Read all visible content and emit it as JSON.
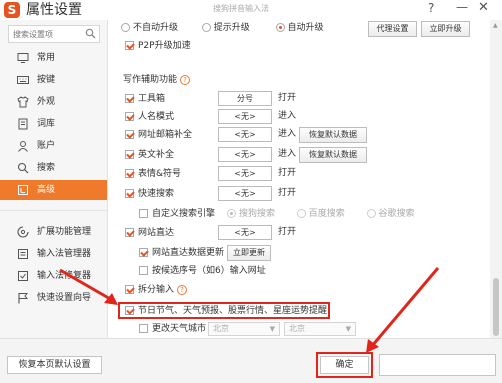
{
  "window": {
    "title": "属性设置",
    "subtitle": "搜狗拼音输入法",
    "help": "?",
    "minimize": "—",
    "close": "✕",
    "logo": "S"
  },
  "sidebar": {
    "search_placeholder": "搜索设置项",
    "items": [
      {
        "label": "常用",
        "icon": "monitor-icon"
      },
      {
        "label": "按键",
        "icon": "keyboard-icon"
      },
      {
        "label": "外观",
        "icon": "shirt-icon"
      },
      {
        "label": "词库",
        "icon": "book-icon"
      },
      {
        "label": "账户",
        "icon": "user-icon"
      },
      {
        "label": "搜索",
        "icon": "search-icon"
      },
      {
        "label": "高级",
        "icon": "advanced-icon",
        "active": true
      }
    ],
    "tools": [
      {
        "label": "扩展功能管理",
        "icon": "extension-icon"
      },
      {
        "label": "输入法管理器",
        "icon": "manager-icon"
      },
      {
        "label": "输入法修复器",
        "icon": "repair-icon"
      },
      {
        "label": "快速设置向导",
        "icon": "flag-icon"
      }
    ]
  },
  "upgrade": {
    "options": [
      "不自动升级",
      "提示升级",
      "自动升级"
    ],
    "selected": "自动升级",
    "proxy_button": "代理设置",
    "upgrade_now_button": "立即升级",
    "p2p_label": "P2P升级加速"
  },
  "writing_assist": {
    "title": "写作辅助功能",
    "help": "?",
    "toolbox": {
      "label": "工具箱",
      "key": "分号",
      "action": "打开"
    },
    "person_name": {
      "label": "人名模式",
      "key": "<无>",
      "action": "进入"
    },
    "url_email": {
      "label": "网址邮箱补全",
      "key": "<无>",
      "action": "进入",
      "button": "恢复默认数据"
    },
    "english": {
      "label": "英文补全",
      "key": "<无>",
      "action": "进入",
      "button": "恢复默认数据"
    },
    "emoji": {
      "label": "表情&符号",
      "key": "<无>",
      "action": "打开"
    },
    "quick_search": {
      "label": "快速搜索",
      "key": "<无>",
      "action": "打开"
    },
    "custom_engine": {
      "label": "自定义搜索引擎",
      "options": [
        "搜狗搜索",
        "百度搜索",
        "谷歌搜索"
      ],
      "selected": "搜狗搜索"
    },
    "site_direct": {
      "label": "网站直达",
      "key": "<无>",
      "action": "打开"
    },
    "site_data_update": {
      "label": "网站直达数据更新",
      "button": "立即更新"
    },
    "select_key_url": {
      "label": "按候选序号（如6）输入网址"
    },
    "split_input": {
      "label": "拆分输入",
      "help": "?"
    },
    "holiday_info": {
      "label": "节日节气、天气预报、股票行情、星座运势提醒"
    },
    "weather_city": {
      "label": "更改天气城市",
      "province": "北京",
      "city": "北京"
    }
  },
  "footer": {
    "reset_button": "恢复本页默认设置",
    "ok_button": "确定"
  },
  "colors": {
    "accent": "#f07a2c",
    "check": "#e5541f",
    "annotation": "#e0251b"
  }
}
